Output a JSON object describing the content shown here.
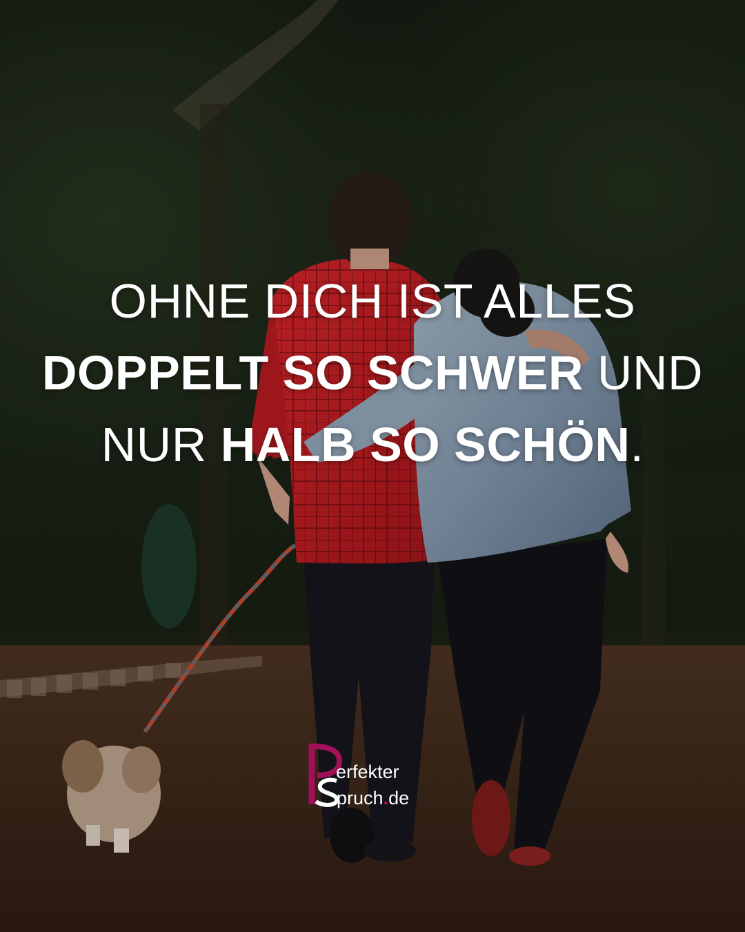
{
  "quote": {
    "line1": {
      "light": "OHNE DICH IST ALLES"
    },
    "line2": {
      "bold": "DOPPELT SO SCHWER",
      "light": " UND"
    },
    "line3": {
      "light": "NUR ",
      "bold": "HALB SO SCHÖN",
      "tail": "."
    }
  },
  "logo": {
    "line1": "erfekter",
    "line2": "pruch",
    "dot": ".",
    "tld": "de",
    "accent_color": "#a3105a"
  }
}
